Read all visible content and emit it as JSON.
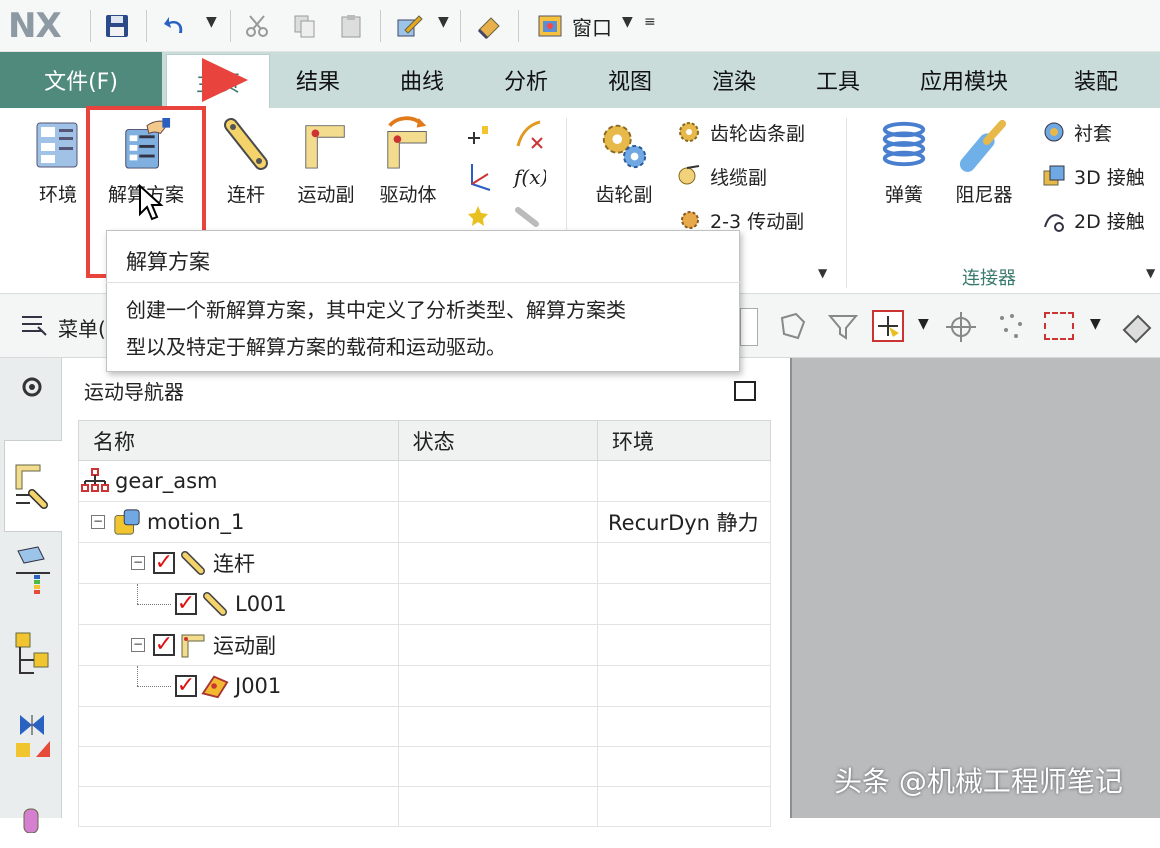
{
  "app": {
    "logo": "NX",
    "window_menu_label": "窗口"
  },
  "tabs": {
    "file": "文件(F)",
    "home": "主页",
    "items": [
      "结果",
      "曲线",
      "分析",
      "视图",
      "渲染",
      "工具",
      "应用模块",
      "装配"
    ]
  },
  "ribbon": {
    "environment": "环境",
    "solution": "解算方案",
    "link": "连杆",
    "joint": "运动副",
    "driver": "驱动体",
    "gear_pair": "齿轮副",
    "rack_pinion": "齿轮齿条副",
    "cable": "线缆副",
    "transmission": "2-3 传动副",
    "spring": "弹簧",
    "damper": "阻尼器",
    "bushing": "衬套",
    "contact_3d": "3D 接触",
    "contact_2d": "2D 接触",
    "connectors_group": "连接器"
  },
  "selection_bar": {
    "menu_label": "菜单("
  },
  "tooltip": {
    "title": "解算方案",
    "line1": "创建一个新解算方案，其中定义了分析类型、解算方案类",
    "line2": "型以及特定于解算方案的载荷和运动驱动。"
  },
  "navigator": {
    "title": "运动导航器",
    "columns": [
      "名称",
      "状态",
      "环境"
    ],
    "rows": [
      {
        "name": "gear_asm",
        "state": "",
        "env": ""
      },
      {
        "name": "motion_1",
        "state": "",
        "env": "RecurDyn 静力"
      },
      {
        "name": "连杆",
        "state": "",
        "env": ""
      },
      {
        "name": "L001",
        "state": "",
        "env": ""
      },
      {
        "name": "运动副",
        "state": "",
        "env": ""
      },
      {
        "name": "J001",
        "state": "",
        "env": ""
      }
    ]
  },
  "watermark": "头条 @机械工程师笔记",
  "colors": {
    "file_tab": "#4f8a7d",
    "tab_bar": "#c9dcda",
    "highlight": "#e8433c",
    "accent": "#3a7a6e"
  }
}
